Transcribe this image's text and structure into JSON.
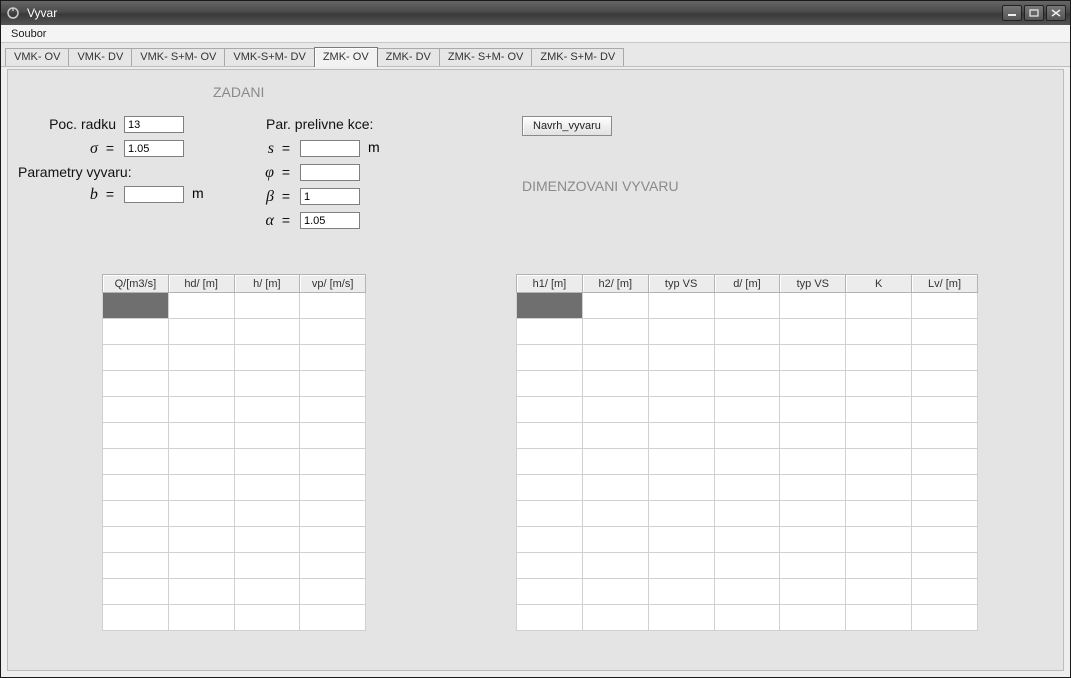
{
  "window": {
    "title": "Vyvar"
  },
  "menu": {
    "file": "Soubor"
  },
  "tabs": [
    {
      "label": "VMK- OV",
      "active": false
    },
    {
      "label": "VMK- DV",
      "active": false
    },
    {
      "label": "VMK- S+M- OV",
      "active": false
    },
    {
      "label": "VMK-S+M- DV",
      "active": false
    },
    {
      "label": "ZMK- OV",
      "active": true
    },
    {
      "label": "ZMK- DV",
      "active": false
    },
    {
      "label": "ZMK- S+M- OV",
      "active": false
    },
    {
      "label": "ZMK- S+M- DV",
      "active": false
    }
  ],
  "sections": {
    "zadani": "ZADANI",
    "dimenzovani": "DIMENZOVANI VYVARU",
    "par_prelivne": "Par. prelivne kce:",
    "par_vyvaru": "Parametry vyvaru:"
  },
  "labels": {
    "poc_radku": "Poc. radku",
    "sigma": "σ",
    "b": "b",
    "s": "s",
    "phi": "φ",
    "beta": "β",
    "alpha": "α",
    "eq": "=",
    "m": "m"
  },
  "inputs": {
    "poc_radku": "13",
    "sigma": "1.05",
    "b": "",
    "s": "",
    "phi": "",
    "beta": "1",
    "alpha": "1.05"
  },
  "buttons": {
    "navrh": "Navrh_vyvaru"
  },
  "table_left": {
    "columns": [
      "Q/[m3/s]",
      "hd/ [m]",
      "h/ [m]",
      "vp/ [m/s]"
    ],
    "rows": 13
  },
  "table_right": {
    "columns": [
      "h1/ [m]",
      "h2/ [m]",
      "typ VS",
      "d/ [m]",
      "typ VS",
      "K",
      "Lv/ [m]"
    ],
    "rows": 13
  }
}
